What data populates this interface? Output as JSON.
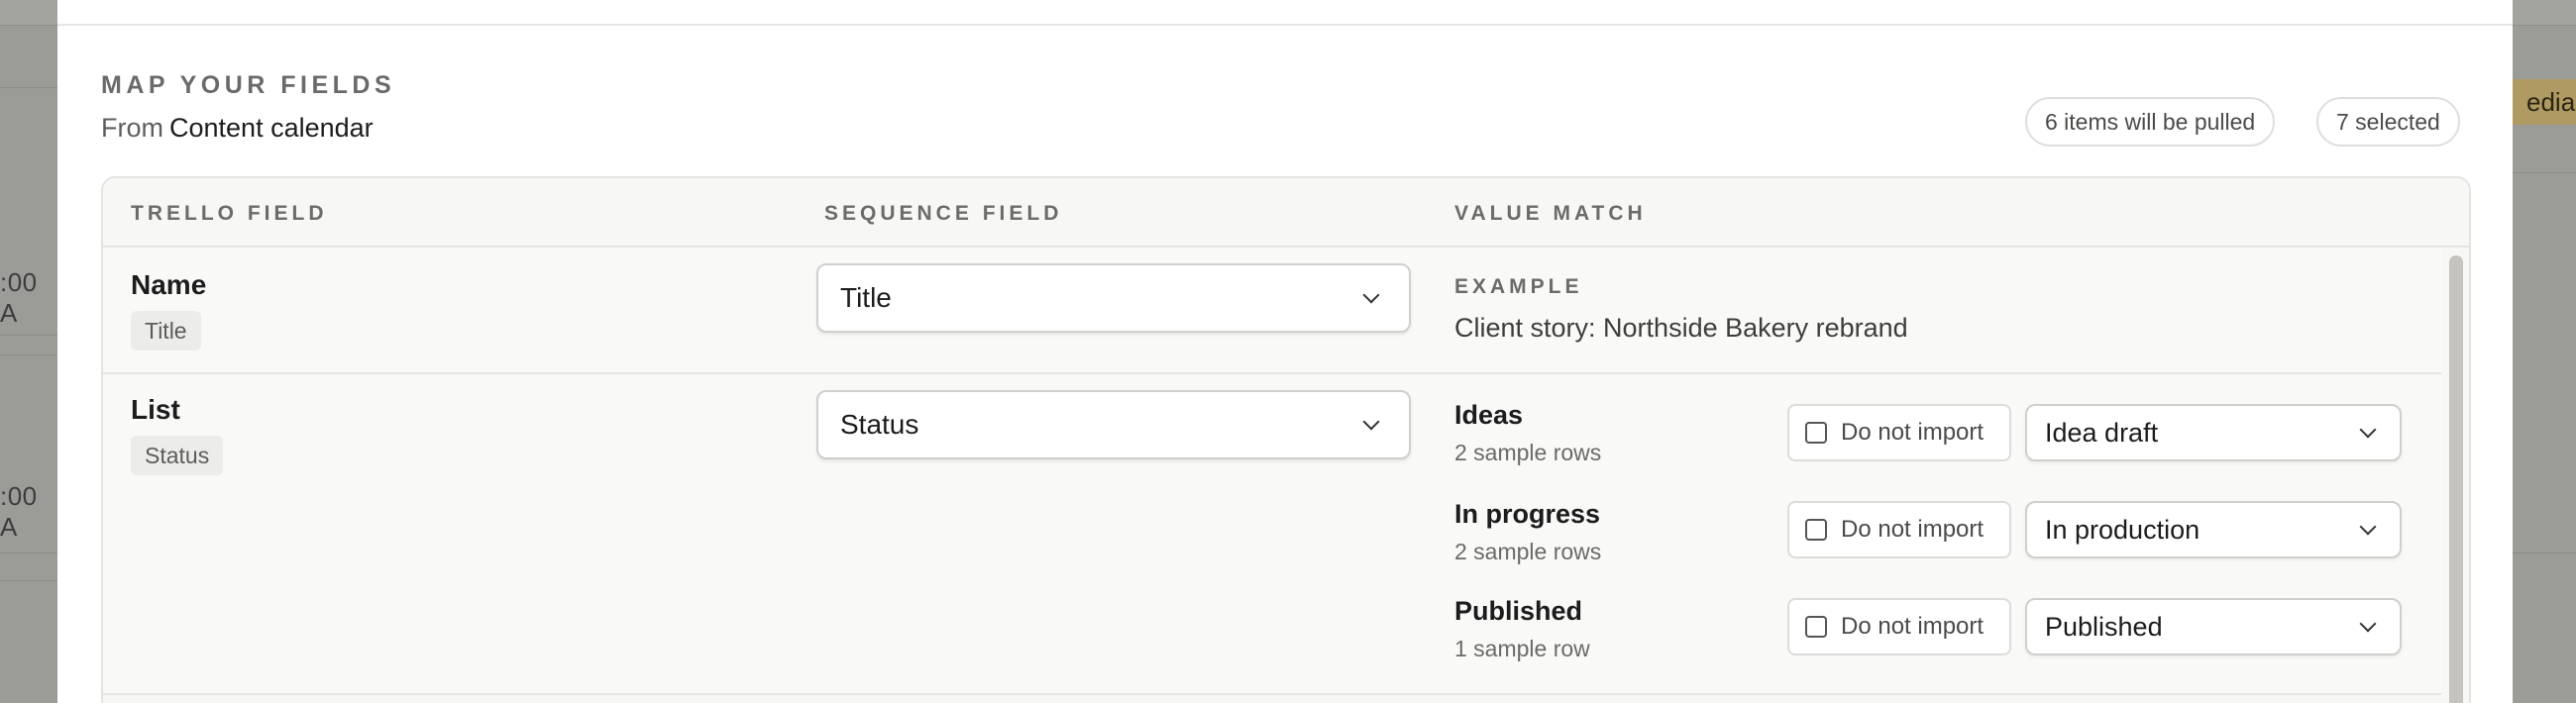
{
  "background": {
    "left_times": [
      ":00 A",
      ":00 A"
    ],
    "right_tag": "edia r"
  },
  "modal": {
    "title": "MAP YOUR FIELDS",
    "from_prefix": "From",
    "from_source": "Content calendar",
    "items_pulled": "6 items will be pulled",
    "selected_count": "7 selected"
  },
  "table": {
    "headers": {
      "trello": "TRELLO FIELD",
      "sequence": "SEQUENCE FIELD",
      "value": "VALUE MATCH"
    },
    "rows": [
      {
        "name": "Name",
        "type_chip": "Title",
        "sequence_field": "Title",
        "example_label": "EXAMPLE",
        "example_value": "Client story: Northside Bakery rebrand"
      },
      {
        "name": "List",
        "type_chip": "Status",
        "sequence_field": "Status",
        "values": [
          {
            "name": "Ideas",
            "count": "2 sample rows",
            "do_not_import": "Do not import",
            "mapped": "Idea draft"
          },
          {
            "name": "In progress",
            "count": "2 sample rows",
            "do_not_import": "Do not import",
            "mapped": "In production"
          },
          {
            "name": "Published",
            "count": "1 sample row",
            "do_not_import": "Do not import",
            "mapped": "Published"
          }
        ]
      }
    ]
  },
  "colors": {
    "overlay": "#9a9a97",
    "modal_bg": "#ffffff",
    "table_bg": "#f7f7f6",
    "border": "#e4e4e1",
    "tag": "#b09a63",
    "scroll_thumb": "#c6c4bf"
  }
}
